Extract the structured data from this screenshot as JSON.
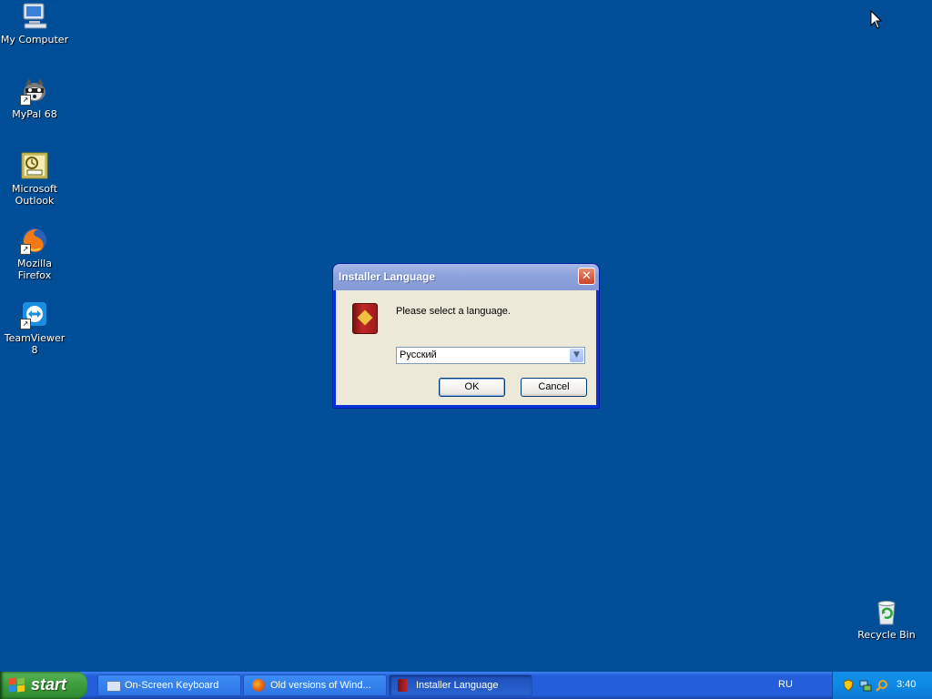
{
  "desktop": {
    "icons": [
      {
        "label": "My Computer"
      },
      {
        "label": "MyPal 68"
      },
      {
        "label": "Microsoft\nOutlook"
      },
      {
        "label": "Mozilla Firefox"
      },
      {
        "label": "TeamViewer 8"
      },
      {
        "label": "Recycle Bin"
      }
    ]
  },
  "dialog": {
    "title": "Installer Language",
    "close_glyph": "✕",
    "prompt": "Please select a language.",
    "language_select": {
      "value": "Русский"
    },
    "ok_label": "OK",
    "cancel_label": "Cancel"
  },
  "taskbar": {
    "start_label": "start",
    "buttons": [
      {
        "label": "On-Screen Keyboard",
        "icon": "keyboard-icon"
      },
      {
        "label": "Old versions of Wind...",
        "icon": "firefox-icon"
      },
      {
        "label": "Installer Language",
        "icon": "installer-icon"
      }
    ],
    "language_indicator": "RU",
    "clock": "3:40"
  },
  "colors": {
    "desktop_bg": "#004e98",
    "dialog_frame": "#0831d9",
    "dialog_body": "#ece9d8",
    "taskbar": "#245edb",
    "start_button": "#3c9c3c",
    "tray": "#0d8ae6"
  }
}
